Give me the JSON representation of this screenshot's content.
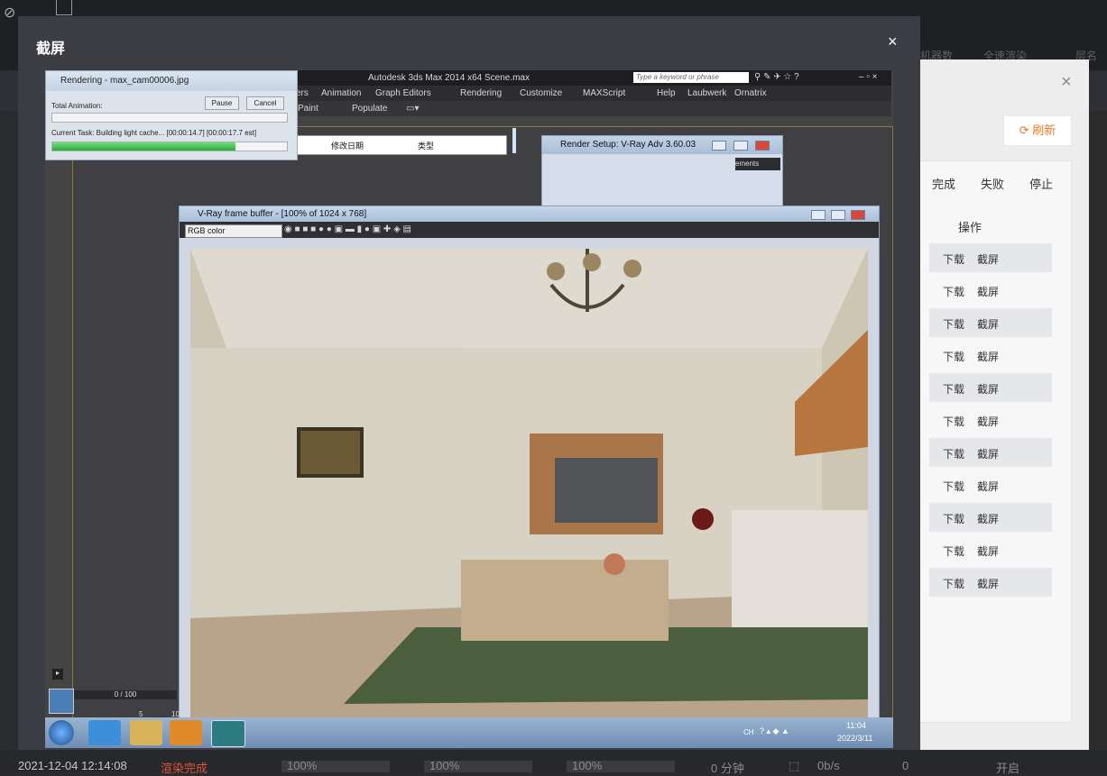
{
  "modal": {
    "title": "截屏",
    "close_glyph": "×"
  },
  "background_app": {
    "header_cols": [
      "机器数",
      "全速渲染",
      "层名"
    ],
    "close_glyph": "×",
    "refresh_label": "⟳ 刷新",
    "status_tabs": [
      "完成",
      "失败",
      "停止"
    ],
    "ops_header": "操作",
    "row_actions": [
      "下载",
      "截屏"
    ],
    "row_count": 11,
    "bottom_row": {
      "datetime": "2021-12-04 12:14:08",
      "status": "渲染完成",
      "pct1": "100%",
      "pct2": "100%",
      "pct3": "100%",
      "time": "0 分钟",
      "speed": "0b/s",
      "count": "0",
      "action": "开启"
    },
    "accent_color": "#e57c1f"
  },
  "screenshot": {
    "max_title": "Autodesk 3ds Max  2014 x64     Scene.max",
    "search_placeholder": "Type a keyword or phrase",
    "menu_items": [
      "ers",
      "Animation",
      "Graph Editors",
      "Rendering",
      "Customize",
      "MAXScript",
      "Help",
      "Laubwerk",
      "Ornatrix"
    ],
    "sub_items": [
      "Paint",
      "Populate"
    ],
    "explorer_cols": [
      "修改日期",
      "类型"
    ],
    "render_setup_title": "Render Setup: V-Ray Adv 3.60.03",
    "render_setup_tab": "ements",
    "rendering": {
      "title": "Rendering - max_cam00006.jpg",
      "pause": "Pause",
      "cancel": "Cancel",
      "total_label": "Total Animation:",
      "total_progress": 0,
      "task_label": "Current Task:   Building light cache... [00:00:14.7] [00:00:17.7 est]",
      "task_progress": 0.78
    },
    "vfb": {
      "title": "V-Ray frame buffer - [100% of 1024 x 768]",
      "channel": "RGB color"
    },
    "timeline": {
      "frame": "0 / 100",
      "ticks": [
        "5",
        "10"
      ]
    },
    "tray": {
      "lang": "CH",
      "time": "11:04",
      "date": "2022/3/11"
    }
  }
}
